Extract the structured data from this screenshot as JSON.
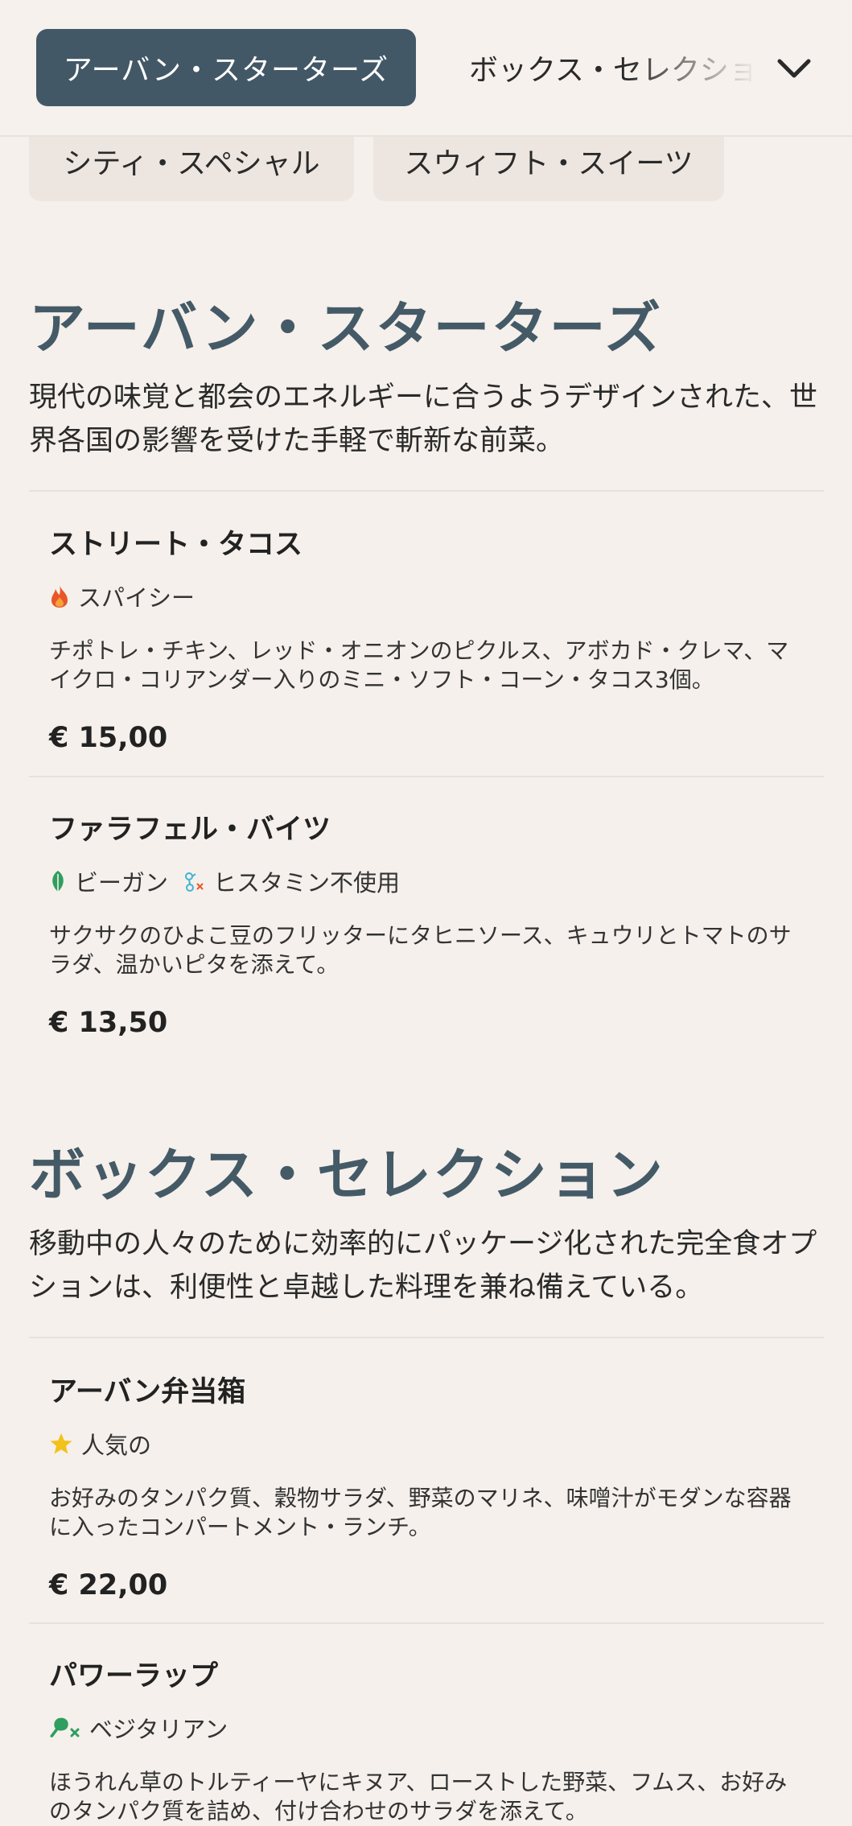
{
  "nav": {
    "active_tab": "アーバン・スターターズ",
    "next_tab": "ボックス・セレクション",
    "pills": [
      "シティ・スペシャル",
      "スウィフト・スイーツ"
    ]
  },
  "sections": [
    {
      "title": "アーバン・スターターズ",
      "description": "現代の味覚と都会のエネルギーに合うようデザインされた、世界各国の影響を受けた手軽で斬新な前菜。",
      "items": [
        {
          "name": "ストリート・タコス",
          "tags": [
            {
              "icon": "flame-icon",
              "label": "スパイシー"
            }
          ],
          "description": "チポトレ・チキン、レッド・オニオンのピクルス、アボカド・クレマ、マイクロ・コリアンダー入りのミニ・ソフト・コーン・タコス3個。",
          "price": "€ 15,00"
        },
        {
          "name": "ファラフェル・バイツ",
          "tags": [
            {
              "icon": "leaf-icon",
              "label": "ビーガン"
            },
            {
              "icon": "no-histamine-icon",
              "label": "ヒスタミン不使用"
            }
          ],
          "description": "サクサクのひよこ豆のフリッターにタヒニソース、キュウリとトマトのサラダ、温かいピタを添えて。",
          "price": "€ 13,50"
        }
      ]
    },
    {
      "title": "ボックス・セレクション",
      "description": "移動中の人々のために効率的にパッケージ化された完全食オプションは、利便性と卓越した料理を兼ね備えている。",
      "items": [
        {
          "name": "アーバン弁当箱",
          "tags": [
            {
              "icon": "star-icon",
              "label": "人気の"
            }
          ],
          "description": "お好みのタンパク質、穀物サラダ、野菜のマリネ、味噌汁がモダンな容器に入ったコンパートメント・ランチ。",
          "price": "€ 22,00"
        },
        {
          "name": "パワーラップ",
          "tags": [
            {
              "icon": "no-meat-icon",
              "label": "ベジタリアン"
            }
          ],
          "description": "ほうれん草のトルティーヤにキヌア、ローストした野菜、フムス、お好みのタンパク質を詰め、付け合わせのサラダを添えて。"
        }
      ]
    }
  ],
  "colors": {
    "accent": "#455a67",
    "background": "#f5f0eb",
    "flame": "#e8562a",
    "leaf": "#2f9e5e",
    "histamine": "#3fb4d6",
    "star": "#f2c11b"
  }
}
